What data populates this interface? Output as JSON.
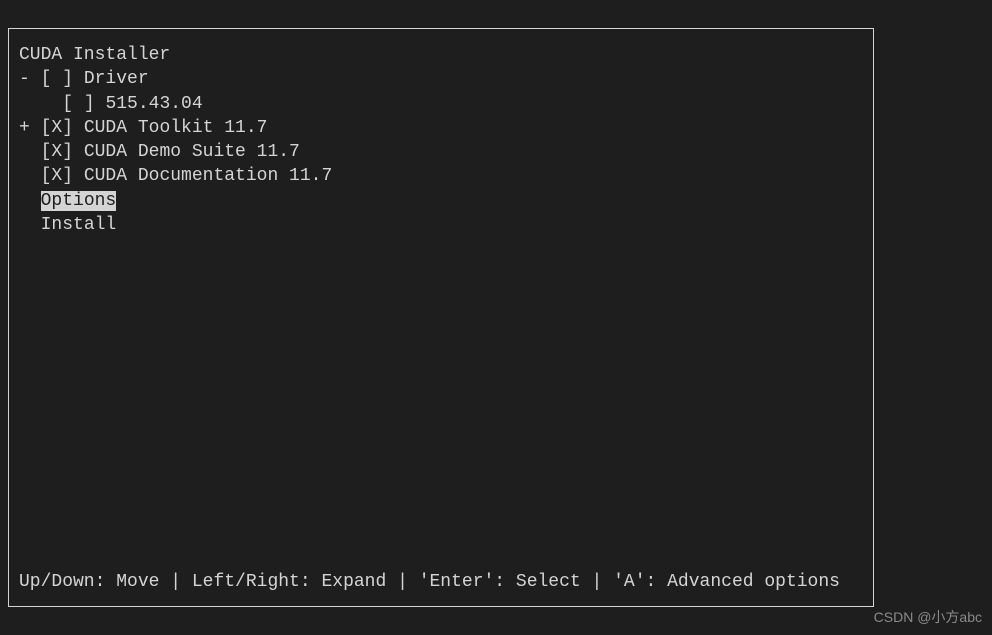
{
  "installer": {
    "title": "CUDA Installer",
    "items": [
      {
        "prefix": "- ",
        "checkbox": "[ ]",
        "label": "Driver"
      },
      {
        "prefix": "    ",
        "checkbox": "[ ]",
        "label": "515.43.04"
      },
      {
        "prefix": "+ ",
        "checkbox": "[X]",
        "label": "CUDA Toolkit 11.7"
      },
      {
        "prefix": "  ",
        "checkbox": "[X]",
        "label": "CUDA Demo Suite 11.7"
      },
      {
        "prefix": "  ",
        "checkbox": "[X]",
        "label": "CUDA Documentation 11.7"
      }
    ],
    "options_label": "Options",
    "options_prefix": "  ",
    "install_label": "Install",
    "install_prefix": "  "
  },
  "footer": {
    "move": "Up/Down: Move",
    "sep": " | ",
    "expand": "Left/Right: Expand",
    "select": "'Enter': Select",
    "advanced": "'A': Advanced options"
  },
  "watermark": "CSDN @小方abc"
}
